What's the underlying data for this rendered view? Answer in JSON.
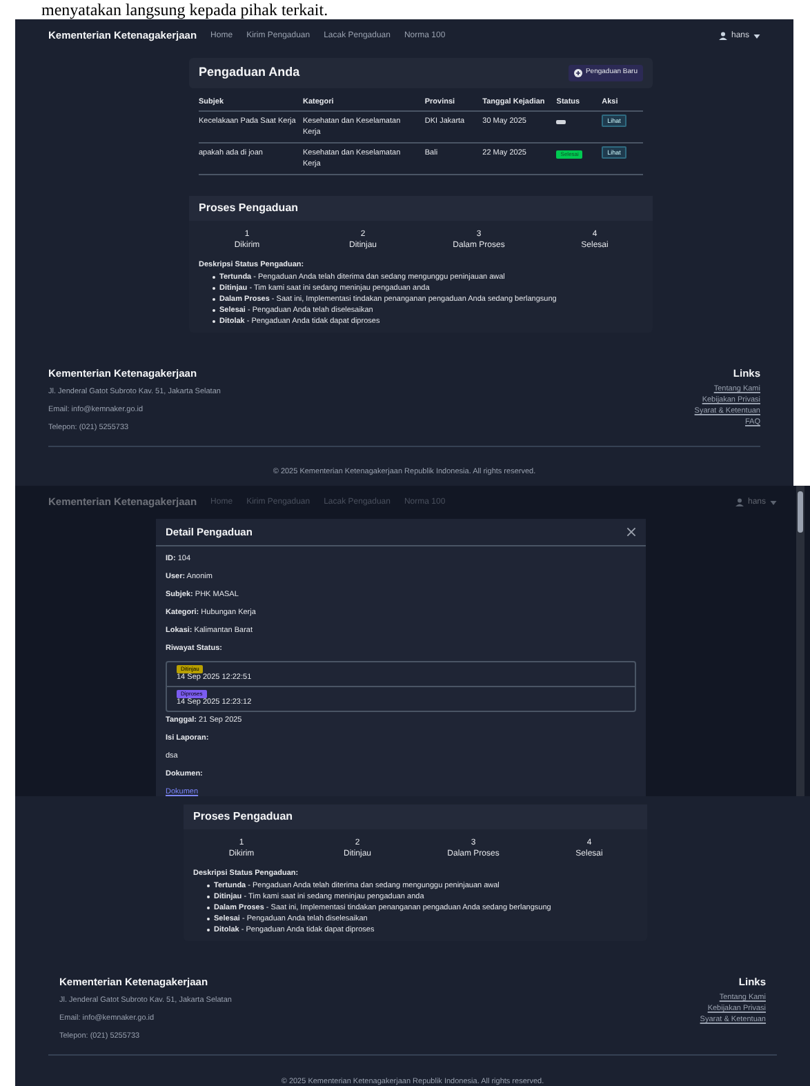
{
  "document_text": "menyatakan langsung kepada pihak terkait.",
  "screenshot_1": {
    "navbar": {
      "brand": "Kementerian Ketenagakerjaan",
      "links": [
        "Home",
        "Kirim Pengaduan",
        "Lacak Pengaduan",
        "Norma 100"
      ],
      "user": "hans"
    },
    "complaints": {
      "title": "Pengaduan Anda",
      "new_button": "Pengaduan Baru",
      "columns": [
        "Subjek",
        "Kategori",
        "Provinsi",
        "Tanggal Kejadian",
        "Status",
        "Aksi"
      ],
      "rows": [
        {
          "subject": "Kecelakaan Pada Saat Kerja",
          "category": "Kesehatan dan Keselamatan Kerja",
          "province": "DKI Jakarta",
          "date": "30 May 2025",
          "status": {
            "kind": "pending"
          },
          "action": "Lihat"
        },
        {
          "subject": "apakah ada di joan",
          "category": "Kesehatan dan Keselamatan Kerja",
          "province": "Bali",
          "date": "22 May 2025",
          "status": {
            "kind": "done",
            "label": "Selesai"
          },
          "action": "Lihat"
        }
      ]
    },
    "process": {
      "title": "Proses Pengaduan",
      "steps": [
        {
          "number": "1",
          "label": "Dikirim"
        },
        {
          "number": "2",
          "label": "Ditinjau"
        },
        {
          "number": "3",
          "label": "Dalam Proses"
        },
        {
          "number": "4",
          "label": "Selesai"
        }
      ],
      "description_title": "Deskripsi Status Pengaduan:",
      "descriptions": [
        "**Tertunda** - Pengaduan Anda telah diterima dan sedang mengunggu peninjauan awal",
        "**Ditinjau** - Tim kami saat ini sedang meninjau pengaduan anda",
        "**Dalam Proses** - Saat ini, Implementasi tindakan penanganan pengaduan Anda sedang berlangsung",
        "**Selesai** - Pengaduan Anda telah diselesaikan",
        "**Ditolak** - Pengaduan Anda tidak dapat diproses"
      ]
    },
    "footer": {
      "title": "Kementerian Ketenagakerjaan",
      "lines": [
        "Jl. Jenderal Gatot Subroto Kav. 51, Jakarta Selatan",
        "Email: info@kemnaker.go.id",
        "Telepon: (021) 5255733"
      ],
      "links_title": "Links",
      "links": [
        "Tentang Kami",
        "Kebijakan Privasi",
        "Syarat & Ketentuan",
        "FAQ"
      ],
      "copyright": "© 2025 Kementerian Ketenagakerjaan Republik Indonesia. All rights reserved."
    }
  },
  "screenshot_2": {
    "navbar": {
      "brand": "Kementerian Ketenagakerjaan",
      "links": [
        "Home",
        "Kirim Pengaduan",
        "Lacak Pengaduan",
        "Norma 100"
      ],
      "user": "hans"
    },
    "modal": {
      "title": "Detail Pengaduan",
      "fields": [
        "**ID:** 104",
        "**User:** Anonim",
        "**Subjek:** PHK MASAL",
        "**Kategori:** Hubungan Kerja",
        "**Lokasi:** Kalimantan Barat"
      ],
      "history_title": "Riwayat Status:",
      "history": [
        {
          "badge": "Ditinjau",
          "color": "#b8a000",
          "time": "14 Sep 2025 12:22:51"
        },
        {
          "badge": "Diproses",
          "color": "#7b5cf0",
          "time": "14 Sep 2025 12:23:12"
        }
      ],
      "date": "**Tanggal:** 21 Sep 2025",
      "report_title": "Isi Laporan:",
      "report": "dsa",
      "document_title": "Dokumen:",
      "document_link": "Dokumen"
    },
    "process": {
      "title": "Proses Pengaduan",
      "steps": [
        {
          "number": "1",
          "label": "Dikirim"
        },
        {
          "number": "2",
          "label": "Ditinjau"
        },
        {
          "number": "3",
          "label": "Dalam Proses"
        },
        {
          "number": "4",
          "label": "Selesai"
        }
      ],
      "description_title": "Deskripsi Status Pengaduan:",
      "descriptions": [
        "**Tertunda** - Pengaduan Anda telah diterima dan sedang mengunggu peninjauan awal",
        "**Ditinjau** - Tim kami saat ini sedang meninjau pengaduan anda",
        "**Dalam Proses** - Saat ini, Implementasi tindakan penanganan pengaduan Anda sedang berlangsung",
        "**Selesai** - Pengaduan Anda telah diselesaikan",
        "**Ditolak** - Pengaduan Anda tidak dapat diproses"
      ]
    },
    "footer": {
      "title": "Kementerian Ketenagakerjaan",
      "lines": [
        "Jl. Jenderal Gatot Subroto Kav. 51, Jakarta Selatan",
        "Email: info@kemnaker.go.id",
        "Telepon: (021) 5255733"
      ],
      "links_title": "Links",
      "links": [
        "Tentang Kami",
        "Kebijakan Privasi",
        "Syarat & Ketentuan"
      ],
      "copyright": "© 2025 Kementerian Ketenagakerjaan Republik Indonesia. All rights reserved."
    }
  }
}
